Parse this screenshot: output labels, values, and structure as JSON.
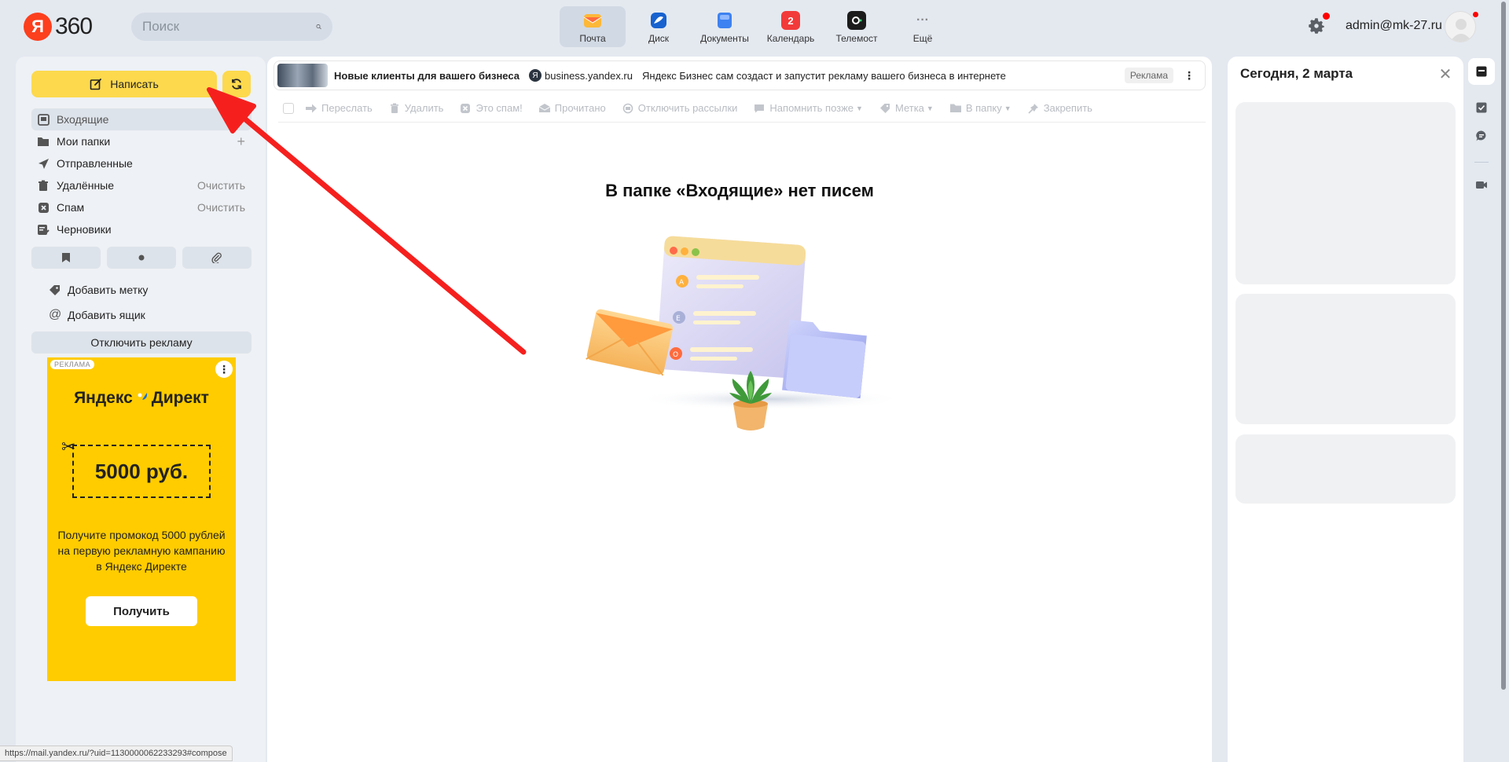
{
  "header": {
    "logo_text": "360",
    "logo_letter": "Я",
    "search_placeholder": "Поиск",
    "services": [
      {
        "label": "Почта",
        "icon": "mail-icon",
        "color": "#fcb23d",
        "active": true
      },
      {
        "label": "Диск",
        "icon": "disk-icon",
        "color": "#1a6ed8"
      },
      {
        "label": "Документы",
        "icon": "documents-icon",
        "color": "#3d82f0"
      },
      {
        "label": "Календарь",
        "icon": "calendar-icon",
        "color": "#f23a3a",
        "badge": "2"
      },
      {
        "label": "Телемост",
        "icon": "telemost-icon",
        "color": "#1b1b1b"
      },
      {
        "label": "Ещё",
        "icon": "more-icon",
        "color": "#888888"
      }
    ],
    "user_email": "admin@mk-27.ru"
  },
  "sidebar": {
    "compose_label": "Написать",
    "folders": [
      {
        "label": "Входящие",
        "icon": "inbox-icon",
        "active": true
      },
      {
        "label": "Мои папки",
        "icon": "folder-icon",
        "action": "+"
      },
      {
        "label": "Отправленные",
        "icon": "sent-icon"
      },
      {
        "label": "Удалённые",
        "icon": "trash-icon",
        "action": "Очистить"
      },
      {
        "label": "Спам",
        "icon": "spam-icon",
        "action": "Очистить"
      },
      {
        "label": "Черновики",
        "icon": "drafts-icon"
      }
    ],
    "add_label": "Добавить метку",
    "add_mailbox": "Добавить ящик",
    "disable_ads": "Отключить рекламу",
    "ad": {
      "badge": "РЕКЛАМА",
      "brand_left": "Яндекс",
      "brand_right": "Директ",
      "coupon": "5000 руб.",
      "text": "Получите промокод 5000 рублей на первую рекламную кампанию в Яндекс Директе",
      "cta": "Получить",
      "accent": "#ffcc00"
    }
  },
  "status_url": "https://mail.yandex.ru/?uid=1130000062233293#compose",
  "main": {
    "ad_banner": {
      "title": "Новые клиенты для вашего бизнеса",
      "domain": "business.yandex.ru",
      "description": "Яндекс Бизнес сам создаст и запустит рекламу вашего бизнеса в интернете",
      "label": "Реклама"
    },
    "toolbar": [
      {
        "label": "Переслать",
        "icon": "forward-icon"
      },
      {
        "label": "Удалить",
        "icon": "delete-icon"
      },
      {
        "label": "Это спам!",
        "icon": "spam-mark-icon"
      },
      {
        "label": "Прочитано",
        "icon": "read-icon"
      },
      {
        "label": "Отключить рассылки",
        "icon": "unsubscribe-icon"
      },
      {
        "label": "Напомнить позже",
        "icon": "remind-icon",
        "caret": true
      },
      {
        "label": "Метка",
        "icon": "label-icon",
        "caret": true
      },
      {
        "label": "В папку",
        "icon": "move-folder-icon",
        "caret": true
      },
      {
        "label": "Закрепить",
        "icon": "pin-icon"
      }
    ],
    "empty_title": "В папке «Входящие» нет писем"
  },
  "right_panel": {
    "title": "Сегодня, 2 марта"
  },
  "colors": {
    "accent_yellow": "#fcd94d",
    "arrow_red": "#f5201e",
    "background": "#e4e9f0"
  }
}
